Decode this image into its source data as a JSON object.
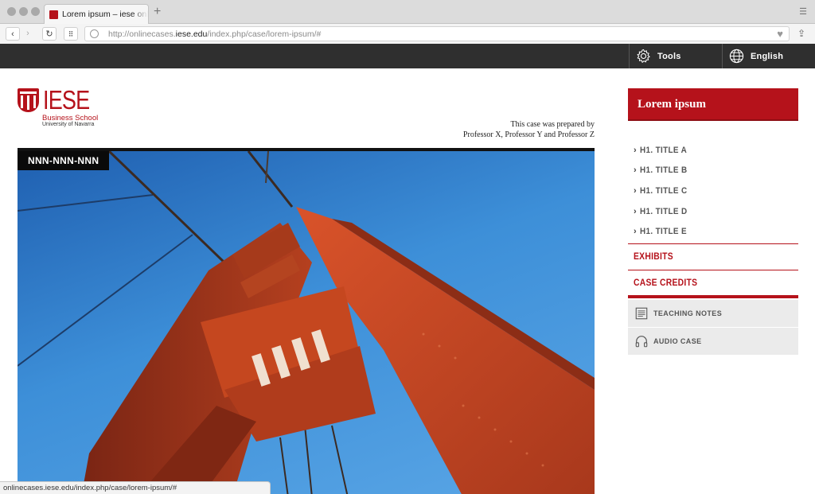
{
  "browser": {
    "tab_title": "Lorem ipsum – iese online case",
    "new_tab": "+",
    "url_prefix": "http://onlinecases.",
    "url_domain": "iese.edu",
    "url_path": "/index.php/case/lorem-ipsum/#",
    "status_url": "onlinecases.iese.edu/index.php/case/lorem-ipsum/#"
  },
  "topbar": {
    "tools_label": "Tools",
    "language_label": "English"
  },
  "logo": {
    "name": "IESE",
    "school": "Business School",
    "university": "University of Navarra"
  },
  "case": {
    "prepared_line1": "This case was prepared by",
    "prepared_line2": "Professor X, Professor Y and Professor Z",
    "code": "NNN-NNN-NNN",
    "title": "Lorem ipsum"
  },
  "sidebar": {
    "toc": [
      {
        "label": "H1. TITLE A"
      },
      {
        "label": "H1. TITLE B"
      },
      {
        "label": "H1. TITLE C"
      },
      {
        "label": "H1. TITLE D"
      },
      {
        "label": "H1. TITLE E"
      }
    ],
    "exhibits": "EXHIBITS",
    "case_credits": "CASE CREDITS",
    "teaching_notes": "TEACHING NOTES",
    "audio_case": "AUDIO CASE"
  },
  "colors": {
    "brand_red": "#b5121b",
    "topbar_bg": "#2f2f2f"
  },
  "icons": [
    "gear-icon",
    "globe-icon",
    "chevron-right-icon",
    "document-icon",
    "headphones-icon"
  ]
}
